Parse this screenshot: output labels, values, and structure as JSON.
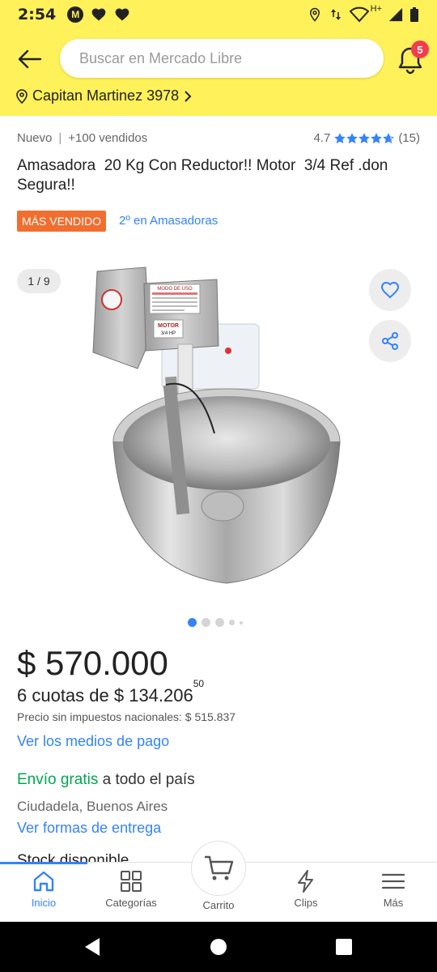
{
  "status_bar": {
    "time": "2:54",
    "network": "H+"
  },
  "search": {
    "placeholder": "Buscar en Mercado Libre"
  },
  "notifications": {
    "count": "5"
  },
  "location": {
    "text": "Capitan Martinez 3978"
  },
  "product": {
    "condition": "Nuevo",
    "separator": "|",
    "sold": "+100 vendidos",
    "rating_value": "4.7",
    "rating_stars": 4.7,
    "review_count": "(15)",
    "title": "Amasadora  20 Kg Con Reductor!! Motor  3/4 Ref .don Segura!!",
    "best_seller_badge": "MÁS VENDIDO",
    "rank_text": "2º en Amasadoras",
    "image_counter": "1 / 9",
    "image_label_top": "MODO DE USO",
    "image_label_motor": "MOTOR",
    "image_label_hp": "3/4 HP",
    "price": "$ 570.000",
    "installments_prefix": "6 cuotas de $ 134.206",
    "installments_cents": "50",
    "price_no_tax": "Precio sin impuestos nacionales: $ 515.837",
    "payment_link": "Ver los medios de pago",
    "shipping_free": "Envío gratis",
    "shipping_rest": " a todo el país",
    "origin": "Ciudadela, Buenos Aires",
    "delivery_link": "Ver formas de entrega",
    "next_section_partial": "Stock disponible"
  },
  "colors": {
    "header_yellow": "#fff159",
    "link_blue": "#3483fa",
    "badge_orange": "#f26e2f",
    "free_green": "#00a650",
    "notification_red": "#f23d4f"
  },
  "bottom_nav": {
    "items": [
      {
        "label": "Inicio",
        "icon": "home-icon",
        "active": true
      },
      {
        "label": "Categorías",
        "icon": "grid-icon",
        "active": false
      },
      {
        "label": "Carrito",
        "icon": "cart-icon",
        "active": false
      },
      {
        "label": "Clips",
        "icon": "clips-icon",
        "active": false
      },
      {
        "label": "Más",
        "icon": "menu-icon",
        "active": false
      }
    ]
  }
}
